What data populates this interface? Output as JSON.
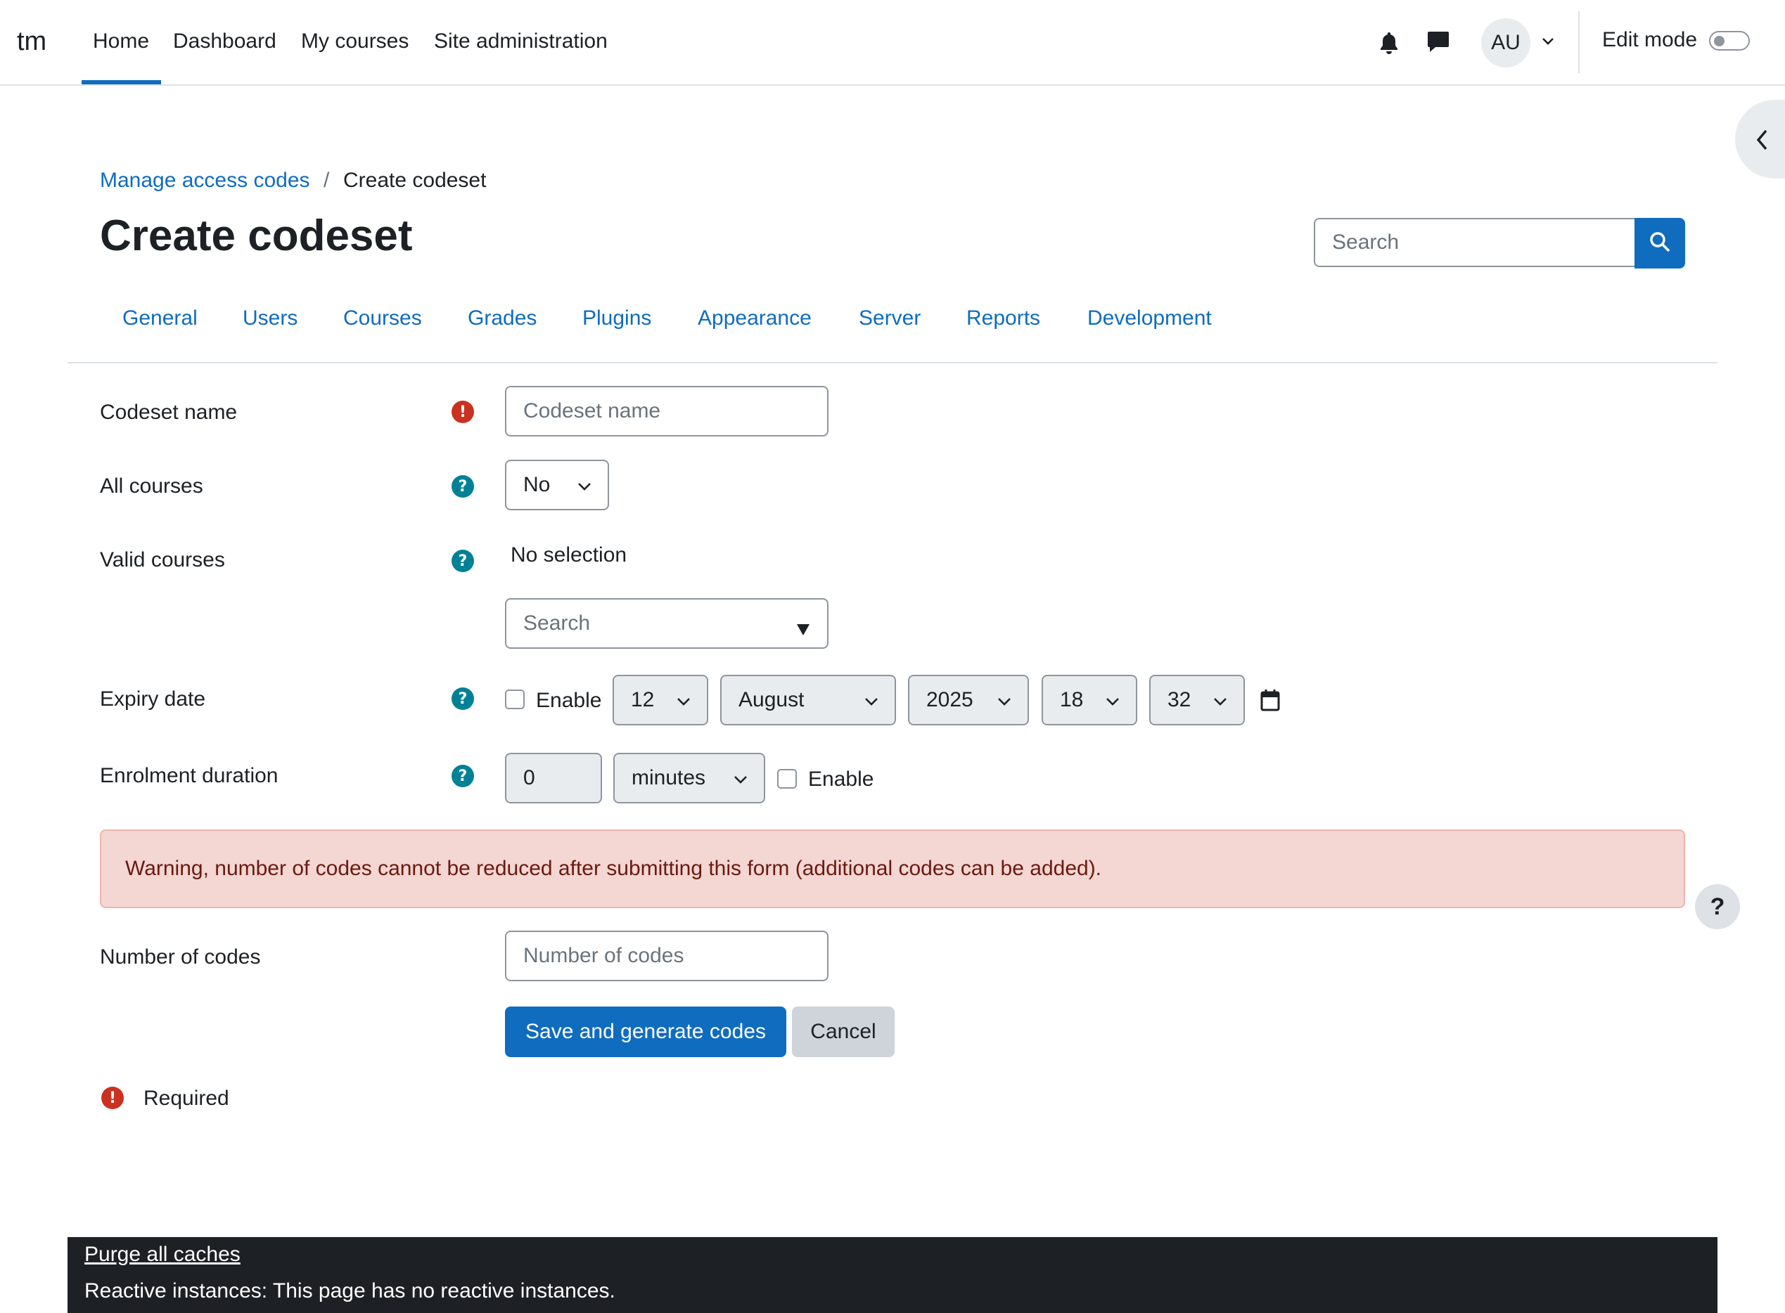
{
  "navbar": {
    "brand": "tm",
    "links": [
      "Home",
      "Dashboard",
      "My courses",
      "Site administration"
    ],
    "active": "Home",
    "avatar_initials": "AU",
    "edit_mode_label": "Edit mode",
    "edit_mode_on": false
  },
  "breadcrumb": {
    "parent": "Manage access codes",
    "separator": "/",
    "current": "Create codeset"
  },
  "page_title": "Create codeset",
  "header_search": {
    "placeholder": "Search"
  },
  "tabs": [
    "General",
    "Users",
    "Courses",
    "Grades",
    "Plugins",
    "Appearance",
    "Server",
    "Reports",
    "Development"
  ],
  "form": {
    "codeset_name": {
      "label": "Codeset name",
      "placeholder": "Codeset name",
      "required": true
    },
    "all_courses": {
      "label": "All courses",
      "value": "No"
    },
    "valid_courses": {
      "label": "Valid courses",
      "selection_text": "No selection",
      "search_placeholder": "Search"
    },
    "expiry_date": {
      "label": "Expiry date",
      "enable_label": "Enable",
      "enabled": false,
      "day": "12",
      "month": "August",
      "year": "2025",
      "hour": "18",
      "minute": "32"
    },
    "enrolment_duration": {
      "label": "Enrolment duration",
      "value": "0",
      "unit": "minutes",
      "enable_label": "Enable",
      "enabled": false
    },
    "warning": "Warning, number of codes cannot be reduced after submitting this form (additional codes can be added).",
    "number_of_codes": {
      "label": "Number of codes",
      "placeholder": "Number of codes"
    },
    "submit_label": "Save and generate codes",
    "cancel_label": "Cancel",
    "required_legend": "Required"
  },
  "footer": {
    "purge_link": "Purge all caches",
    "reactive_text": "Reactive instances: This page has no reactive instances."
  },
  "colors": {
    "primary": "#0f6cbf",
    "required": "#ca3120",
    "help": "#008196",
    "alert_bg": "#f4d6d2",
    "footer_bg": "#1d2125"
  },
  "icons": [
    "bell-icon",
    "chat-icon",
    "chevron-down-icon",
    "chevron-left-icon",
    "search-icon",
    "calendar-icon",
    "question-icon",
    "exclamation-icon"
  ]
}
